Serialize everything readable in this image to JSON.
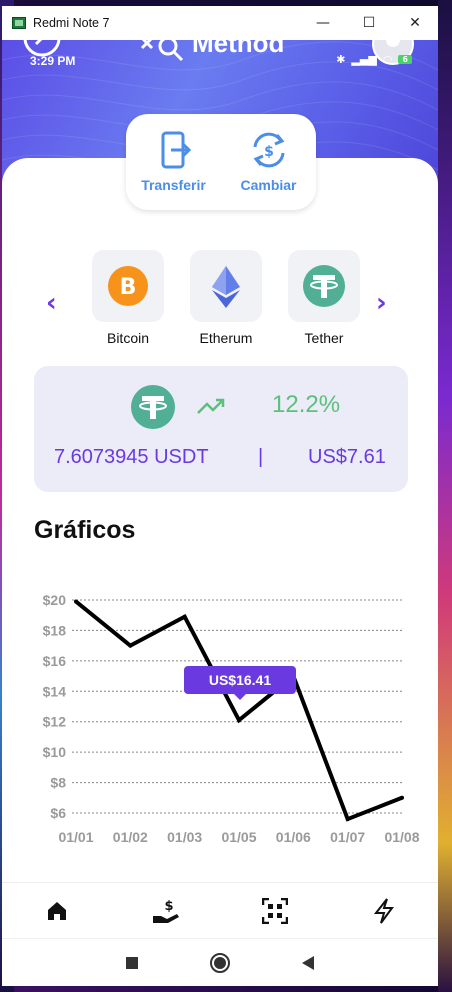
{
  "window": {
    "title": "Redmi Note 7",
    "minimize": "—",
    "maximize": "☐",
    "close": "✕"
  },
  "status_bar": {
    "time": "3:29 PM",
    "battery": "6"
  },
  "header": {
    "app_title": "Method"
  },
  "actions": [
    {
      "label": "Transferir",
      "icon": "transfer-icon"
    },
    {
      "label": "Cambiar",
      "icon": "exchange-icon"
    }
  ],
  "coins": [
    {
      "label": "Bitcoin",
      "icon": "bitcoin-icon",
      "color": "#f7931a"
    },
    {
      "label": "Etherum",
      "icon": "ethereum-icon",
      "color": "#627eea"
    },
    {
      "label": "Tether",
      "icon": "tether-icon",
      "color": "#50af95"
    }
  ],
  "balance": {
    "icon": "tether-icon",
    "change": "12.2%",
    "amount": "7.6073945 USDT",
    "separator": "|",
    "fiat": "US$7.61"
  },
  "section_title": "Gráficos",
  "chart_data": {
    "type": "line",
    "x": [
      "01/01",
      "01/02",
      "01/03",
      "01/05",
      "01/06",
      "01/07",
      "01/08"
    ],
    "values": [
      19.9,
      17.0,
      18.9,
      12.1,
      15.0,
      5.6,
      7.0
    ],
    "y_ticks": [
      "$20",
      "$18",
      "$16",
      "$14",
      "$12",
      "$10",
      "$8",
      "$6"
    ],
    "ylim": [
      6,
      20
    ],
    "tooltip": "US$16.41",
    "grid": true,
    "line_color": "#000000",
    "tooltip_color": "#6a3ae0"
  },
  "bottom_nav": [
    {
      "name": "home-icon"
    },
    {
      "name": "payment-icon"
    },
    {
      "name": "qr-scan-icon"
    },
    {
      "name": "bolt-icon"
    }
  ],
  "system_nav": [
    "recent-apps-icon",
    "home-circle-icon",
    "back-icon"
  ],
  "colors": {
    "accent": "#6a3ae0",
    "positive": "#5cc07a",
    "link": "#4a8ee8"
  }
}
